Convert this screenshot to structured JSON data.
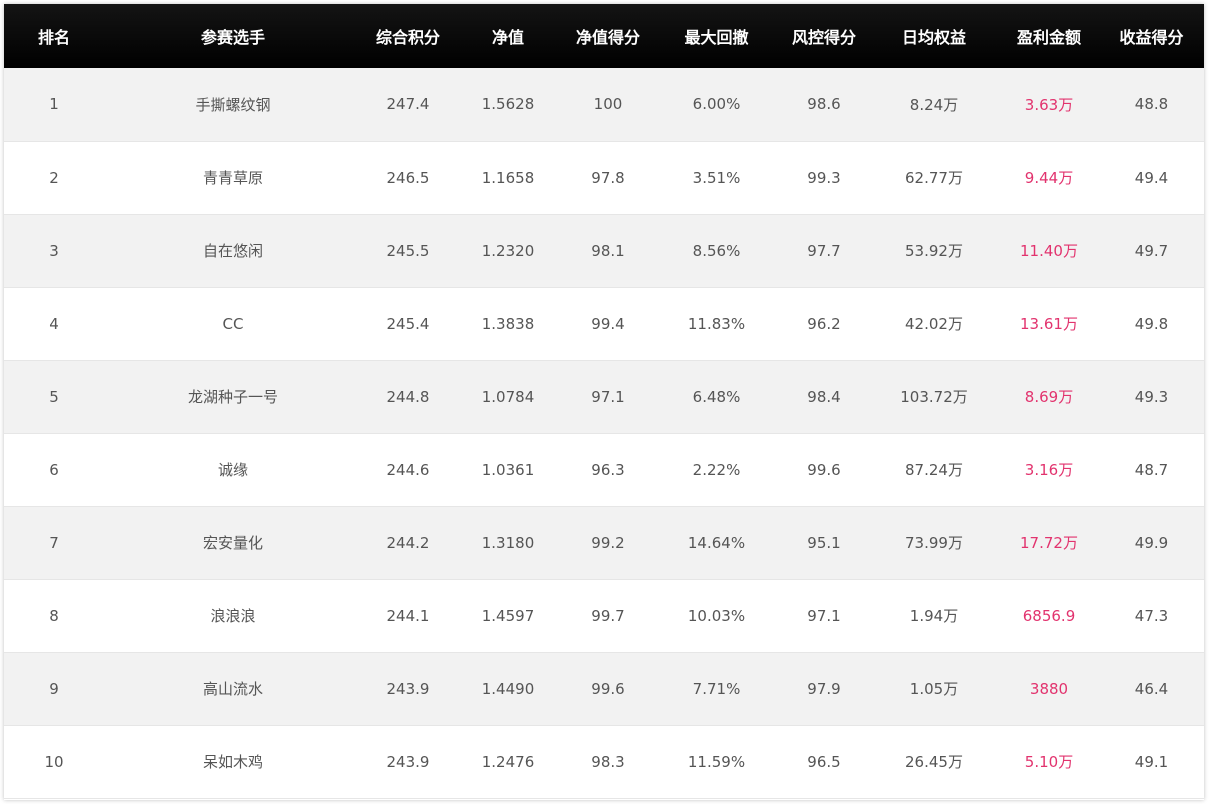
{
  "table": {
    "headers": [
      "排名",
      "参赛选手",
      "综合积分",
      "净值",
      "净值得分",
      "最大回撤",
      "风控得分",
      "日均权益",
      "盈利金额",
      "收益得分"
    ],
    "rows": [
      [
        "1",
        "手撕螺纹钢",
        "247.4",
        "1.5628",
        "100",
        "6.00%",
        "98.6",
        "8.24万",
        "3.63万",
        "48.8"
      ],
      [
        "2",
        "青青草原",
        "246.5",
        "1.1658",
        "97.8",
        "3.51%",
        "99.3",
        "62.77万",
        "9.44万",
        "49.4"
      ],
      [
        "3",
        "自在悠闲",
        "245.5",
        "1.2320",
        "98.1",
        "8.56%",
        "97.7",
        "53.92万",
        "11.40万",
        "49.7"
      ],
      [
        "4",
        "CC",
        "245.4",
        "1.3838",
        "99.4",
        "11.83%",
        "96.2",
        "42.02万",
        "13.61万",
        "49.8"
      ],
      [
        "5",
        "龙湖种子一号",
        "244.8",
        "1.0784",
        "97.1",
        "6.48%",
        "98.4",
        "103.72万",
        "8.69万",
        "49.3"
      ],
      [
        "6",
        "诚缘",
        "244.6",
        "1.0361",
        "96.3",
        "2.22%",
        "99.6",
        "87.24万",
        "3.16万",
        "48.7"
      ],
      [
        "7",
        "宏安量化",
        "244.2",
        "1.3180",
        "99.2",
        "14.64%",
        "95.1",
        "73.99万",
        "17.72万",
        "49.9"
      ],
      [
        "8",
        "浪浪浪",
        "244.1",
        "1.4597",
        "99.7",
        "10.03%",
        "97.1",
        "1.94万",
        "6856.9",
        "47.3"
      ],
      [
        "9",
        "高山流水",
        "243.9",
        "1.4490",
        "99.6",
        "7.71%",
        "97.9",
        "1.05万",
        "3880",
        "46.4"
      ],
      [
        "10",
        "呆如木鸡",
        "243.9",
        "1.2476",
        "98.3",
        "11.59%",
        "96.5",
        "26.45万",
        "5.10万",
        "49.1"
      ]
    ]
  },
  "colors": {
    "header_bg": "#000000",
    "header_text": "#ffffff",
    "row_alt_bg": "#f2f2f2",
    "body_text": "#555555",
    "profit_text": "#e2336e"
  }
}
